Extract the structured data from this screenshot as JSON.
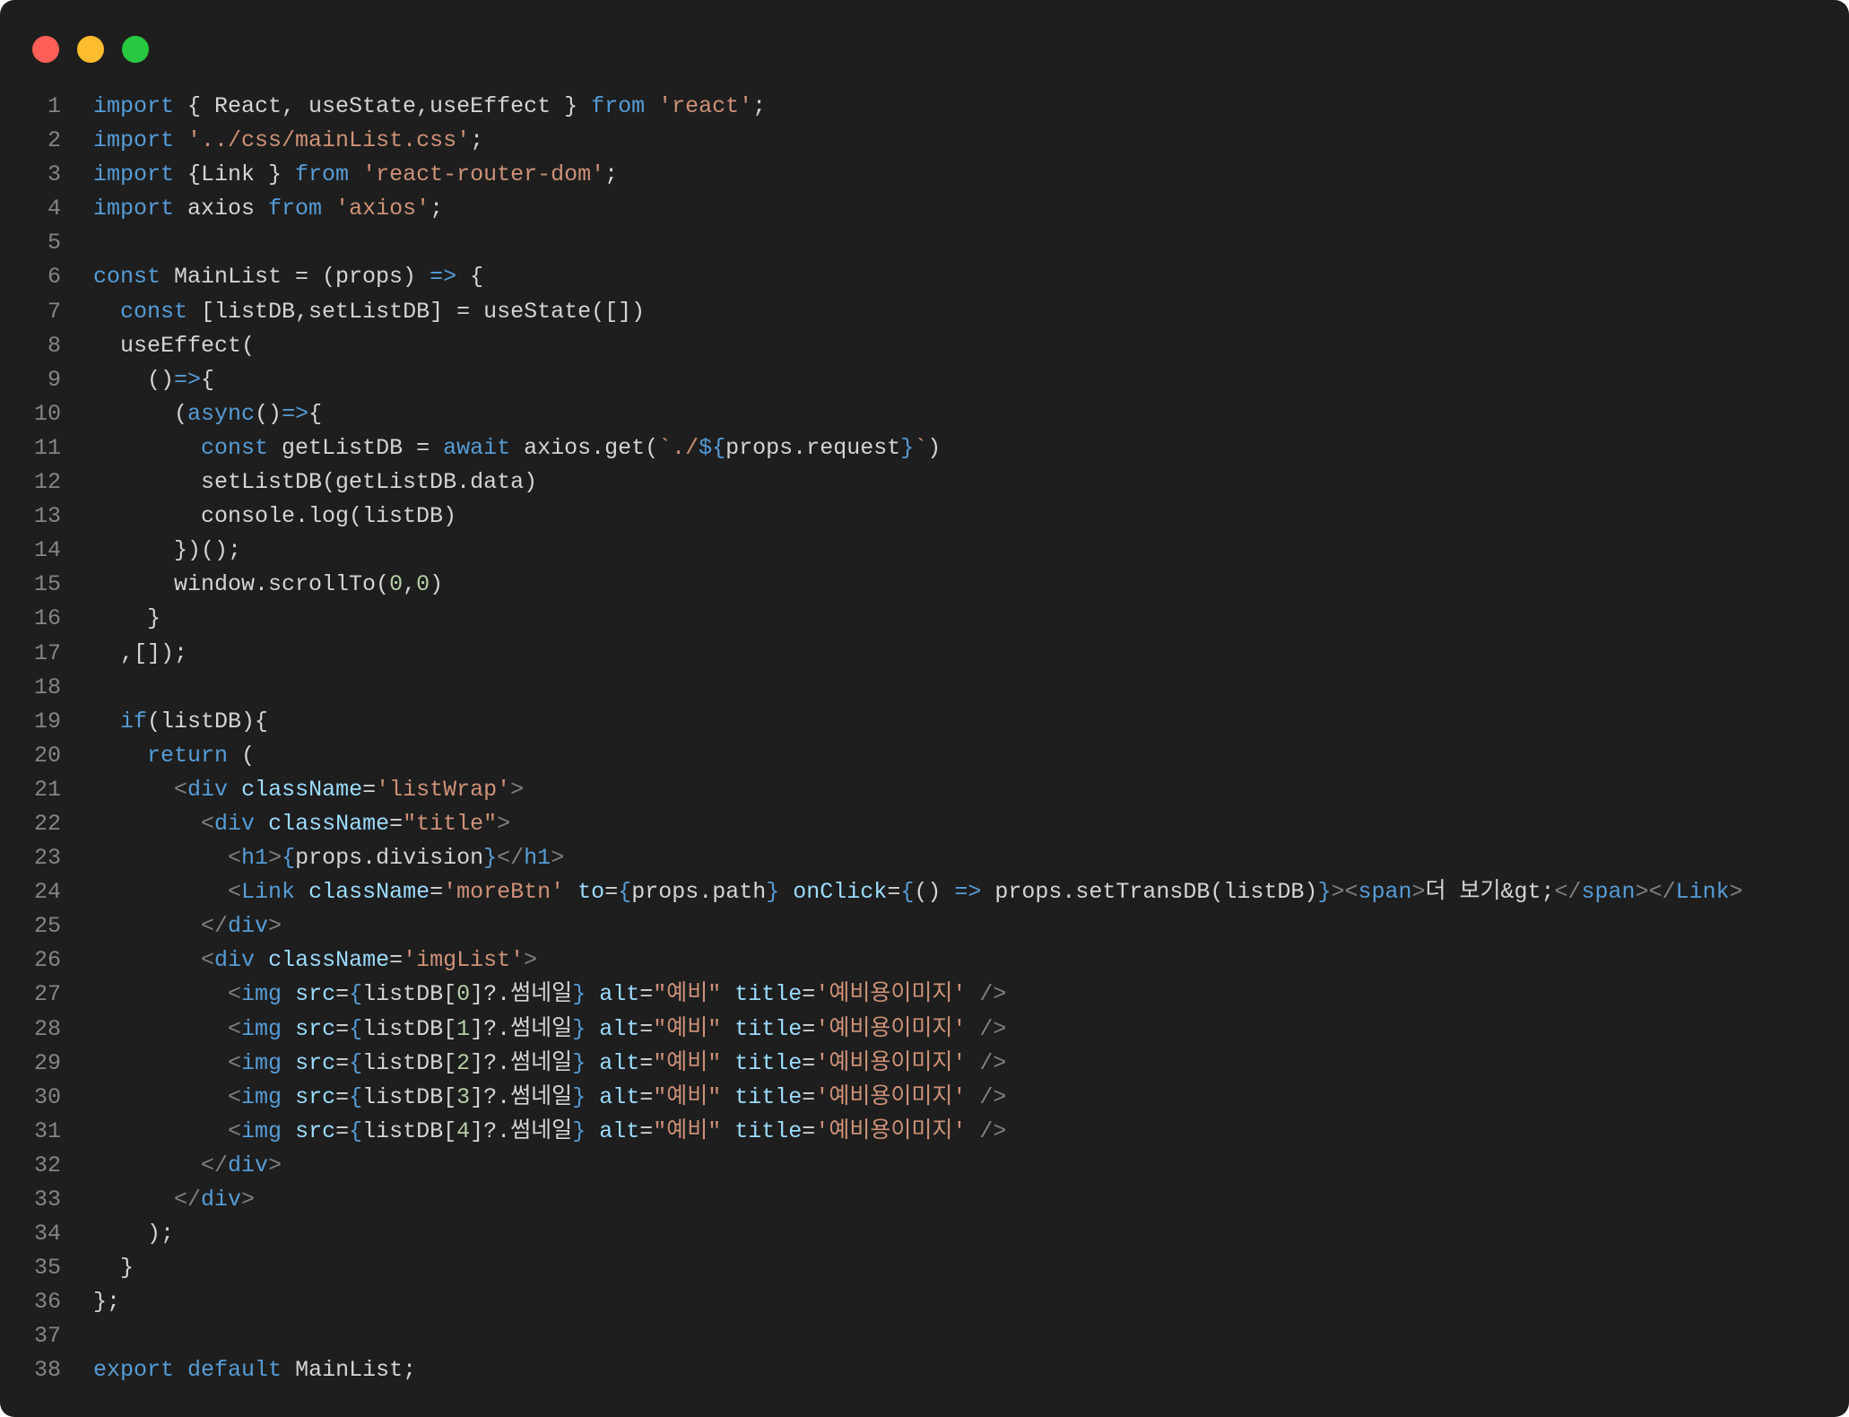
{
  "window": {
    "controls": [
      {
        "name": "close",
        "color": "#ff5f57"
      },
      {
        "name": "minimize",
        "color": "#febc2e"
      },
      {
        "name": "maximize",
        "color": "#28c840"
      }
    ],
    "background": "#1e1e1e"
  },
  "theme": {
    "keyword": "#569cd6",
    "string": "#ce9178",
    "attribute": "#9cdcfe",
    "number": "#b5cea8",
    "punctuation": "#808080",
    "text": "#d4d4d4",
    "line_number": "#858585"
  },
  "code": {
    "language": "jsx",
    "lines": [
      {
        "n": "1",
        "tokens": [
          [
            "kw",
            "import"
          ],
          [
            "txt",
            " { React, useState,useEffect } "
          ],
          [
            "kw",
            "from"
          ],
          [
            "txt",
            " "
          ],
          [
            "str",
            "'react'"
          ],
          [
            "txt",
            ";"
          ]
        ]
      },
      {
        "n": "2",
        "tokens": [
          [
            "kw",
            "import"
          ],
          [
            "txt",
            " "
          ],
          [
            "str",
            "'../css/mainList.css'"
          ],
          [
            "txt",
            ";"
          ]
        ]
      },
      {
        "n": "3",
        "tokens": [
          [
            "kw",
            "import"
          ],
          [
            "txt",
            " {Link } "
          ],
          [
            "kw",
            "from"
          ],
          [
            "txt",
            " "
          ],
          [
            "str",
            "'react-router-dom'"
          ],
          [
            "txt",
            ";"
          ]
        ]
      },
      {
        "n": "4",
        "tokens": [
          [
            "kw",
            "import"
          ],
          [
            "txt",
            " axios "
          ],
          [
            "kw",
            "from"
          ],
          [
            "txt",
            " "
          ],
          [
            "str",
            "'axios'"
          ],
          [
            "txt",
            ";"
          ]
        ]
      },
      {
        "n": "5",
        "tokens": []
      },
      {
        "n": "6",
        "tokens": [
          [
            "kw",
            "const"
          ],
          [
            "txt",
            " MainList = (props) "
          ],
          [
            "kw",
            "=>"
          ],
          [
            "txt",
            " {"
          ]
        ]
      },
      {
        "n": "7",
        "tokens": [
          [
            "txt",
            "  "
          ],
          [
            "kw",
            "const"
          ],
          [
            "txt",
            " [listDB,setListDB] = useState([])"
          ]
        ]
      },
      {
        "n": "8",
        "tokens": [
          [
            "txt",
            "  useEffect("
          ]
        ]
      },
      {
        "n": "9",
        "tokens": [
          [
            "txt",
            "    ()"
          ],
          [
            "kw",
            "=>"
          ],
          [
            "txt",
            "{"
          ]
        ]
      },
      {
        "n": "10",
        "tokens": [
          [
            "txt",
            "      ("
          ],
          [
            "kw",
            "async"
          ],
          [
            "txt",
            "()"
          ],
          [
            "kw",
            "=>"
          ],
          [
            "txt",
            "{"
          ]
        ]
      },
      {
        "n": "11",
        "tokens": [
          [
            "txt",
            "        "
          ],
          [
            "kw",
            "const"
          ],
          [
            "txt",
            " getListDB = "
          ],
          [
            "kw",
            "await"
          ],
          [
            "txt",
            " axios.get("
          ],
          [
            "str",
            "`./"
          ],
          [
            "kw",
            "${"
          ],
          [
            "txt",
            "props.request"
          ],
          [
            "kw",
            "}"
          ],
          [
            "str",
            "`"
          ],
          [
            "txt",
            ")"
          ]
        ]
      },
      {
        "n": "12",
        "tokens": [
          [
            "txt",
            "        setListDB(getListDB.data)"
          ]
        ]
      },
      {
        "n": "13",
        "tokens": [
          [
            "txt",
            "        console.log(listDB)"
          ]
        ]
      },
      {
        "n": "14",
        "tokens": [
          [
            "txt",
            "      })();"
          ]
        ]
      },
      {
        "n": "15",
        "tokens": [
          [
            "txt",
            "      window.scrollTo("
          ],
          [
            "num",
            "0"
          ],
          [
            "txt",
            ","
          ],
          [
            "num",
            "0"
          ],
          [
            "txt",
            ")"
          ]
        ]
      },
      {
        "n": "16",
        "tokens": [
          [
            "txt",
            "    }"
          ]
        ]
      },
      {
        "n": "17",
        "tokens": [
          [
            "txt",
            "  ,[]);"
          ]
        ]
      },
      {
        "n": "18",
        "tokens": []
      },
      {
        "n": "19",
        "tokens": [
          [
            "txt",
            "  "
          ],
          [
            "kw",
            "if"
          ],
          [
            "txt",
            "(listDB){"
          ]
        ]
      },
      {
        "n": "20",
        "tokens": [
          [
            "txt",
            "    "
          ],
          [
            "kw",
            "return"
          ],
          [
            "txt",
            " ("
          ]
        ]
      },
      {
        "n": "21",
        "tokens": [
          [
            "txt",
            "      "
          ],
          [
            "pun",
            "<"
          ],
          [
            "kw",
            "div"
          ],
          [
            "txt",
            " "
          ],
          [
            "attr",
            "className"
          ],
          [
            "txt",
            "="
          ],
          [
            "str",
            "'listWrap'"
          ],
          [
            "pun",
            ">"
          ]
        ]
      },
      {
        "n": "22",
        "tokens": [
          [
            "txt",
            "        "
          ],
          [
            "pun",
            "<"
          ],
          [
            "kw",
            "div"
          ],
          [
            "txt",
            " "
          ],
          [
            "attr",
            "className"
          ],
          [
            "txt",
            "="
          ],
          [
            "str",
            "\"title\""
          ],
          [
            "pun",
            ">"
          ]
        ]
      },
      {
        "n": "23",
        "tokens": [
          [
            "txt",
            "          "
          ],
          [
            "pun",
            "<"
          ],
          [
            "kw",
            "h1"
          ],
          [
            "pun",
            ">"
          ],
          [
            "kw",
            "{"
          ],
          [
            "txt",
            "props.division"
          ],
          [
            "kw",
            "}"
          ],
          [
            "pun",
            "</"
          ],
          [
            "kw",
            "h1"
          ],
          [
            "pun",
            ">"
          ]
        ]
      },
      {
        "n": "24",
        "tokens": [
          [
            "txt",
            "          "
          ],
          [
            "pun",
            "<"
          ],
          [
            "kw",
            "Link"
          ],
          [
            "txt",
            " "
          ],
          [
            "attr",
            "className"
          ],
          [
            "txt",
            "="
          ],
          [
            "str",
            "'moreBtn'"
          ],
          [
            "txt",
            " "
          ],
          [
            "attr",
            "to"
          ],
          [
            "txt",
            "="
          ],
          [
            "kw",
            "{"
          ],
          [
            "txt",
            "props.path"
          ],
          [
            "kw",
            "}"
          ],
          [
            "txt",
            " "
          ],
          [
            "attr",
            "onClick"
          ],
          [
            "txt",
            "="
          ],
          [
            "kw",
            "{"
          ],
          [
            "txt",
            "() "
          ],
          [
            "kw",
            "=>"
          ],
          [
            "txt",
            " props.setTransDB(listDB)"
          ],
          [
            "kw",
            "}"
          ],
          [
            "pun",
            ">"
          ],
          [
            "pun",
            "<"
          ],
          [
            "kw",
            "span"
          ],
          [
            "pun",
            ">"
          ],
          [
            "txt",
            "더 보기&gt;"
          ],
          [
            "pun",
            "</"
          ],
          [
            "kw",
            "span"
          ],
          [
            "pun",
            ">"
          ],
          [
            "pun",
            "</"
          ],
          [
            "kw",
            "Link"
          ],
          [
            "pun",
            ">"
          ]
        ]
      },
      {
        "n": "25",
        "tokens": [
          [
            "txt",
            "        "
          ],
          [
            "pun",
            "</"
          ],
          [
            "kw",
            "div"
          ],
          [
            "pun",
            ">"
          ]
        ]
      },
      {
        "n": "26",
        "tokens": [
          [
            "txt",
            "        "
          ],
          [
            "pun",
            "<"
          ],
          [
            "kw",
            "div"
          ],
          [
            "txt",
            " "
          ],
          [
            "attr",
            "className"
          ],
          [
            "txt",
            "="
          ],
          [
            "str",
            "'imgList'"
          ],
          [
            "pun",
            ">"
          ]
        ]
      },
      {
        "n": "27",
        "tokens": [
          [
            "txt",
            "          "
          ],
          [
            "pun",
            "<"
          ],
          [
            "kw",
            "img"
          ],
          [
            "txt",
            " "
          ],
          [
            "attr",
            "src"
          ],
          [
            "txt",
            "="
          ],
          [
            "kw",
            "{"
          ],
          [
            "txt",
            "listDB["
          ],
          [
            "num",
            "0"
          ],
          [
            "txt",
            "]?.썸네일"
          ],
          [
            "kw",
            "}"
          ],
          [
            "txt",
            " "
          ],
          [
            "attr",
            "alt"
          ],
          [
            "txt",
            "="
          ],
          [
            "str",
            "\"예비\""
          ],
          [
            "txt",
            " "
          ],
          [
            "attr",
            "title"
          ],
          [
            "txt",
            "="
          ],
          [
            "str",
            "'예비용이미지'"
          ],
          [
            "txt",
            " "
          ],
          [
            "pun",
            "/>"
          ]
        ]
      },
      {
        "n": "28",
        "tokens": [
          [
            "txt",
            "          "
          ],
          [
            "pun",
            "<"
          ],
          [
            "kw",
            "img"
          ],
          [
            "txt",
            " "
          ],
          [
            "attr",
            "src"
          ],
          [
            "txt",
            "="
          ],
          [
            "kw",
            "{"
          ],
          [
            "txt",
            "listDB["
          ],
          [
            "num",
            "1"
          ],
          [
            "txt",
            "]?.썸네일"
          ],
          [
            "kw",
            "}"
          ],
          [
            "txt",
            " "
          ],
          [
            "attr",
            "alt"
          ],
          [
            "txt",
            "="
          ],
          [
            "str",
            "\"예비\""
          ],
          [
            "txt",
            " "
          ],
          [
            "attr",
            "title"
          ],
          [
            "txt",
            "="
          ],
          [
            "str",
            "'예비용이미지'"
          ],
          [
            "txt",
            " "
          ],
          [
            "pun",
            "/>"
          ]
        ]
      },
      {
        "n": "29",
        "tokens": [
          [
            "txt",
            "          "
          ],
          [
            "pun",
            "<"
          ],
          [
            "kw",
            "img"
          ],
          [
            "txt",
            " "
          ],
          [
            "attr",
            "src"
          ],
          [
            "txt",
            "="
          ],
          [
            "kw",
            "{"
          ],
          [
            "txt",
            "listDB["
          ],
          [
            "num",
            "2"
          ],
          [
            "txt",
            "]?.썸네일"
          ],
          [
            "kw",
            "}"
          ],
          [
            "txt",
            " "
          ],
          [
            "attr",
            "alt"
          ],
          [
            "txt",
            "="
          ],
          [
            "str",
            "\"예비\""
          ],
          [
            "txt",
            " "
          ],
          [
            "attr",
            "title"
          ],
          [
            "txt",
            "="
          ],
          [
            "str",
            "'예비용이미지'"
          ],
          [
            "txt",
            " "
          ],
          [
            "pun",
            "/>"
          ]
        ]
      },
      {
        "n": "30",
        "tokens": [
          [
            "txt",
            "          "
          ],
          [
            "pun",
            "<"
          ],
          [
            "kw",
            "img"
          ],
          [
            "txt",
            " "
          ],
          [
            "attr",
            "src"
          ],
          [
            "txt",
            "="
          ],
          [
            "kw",
            "{"
          ],
          [
            "txt",
            "listDB["
          ],
          [
            "num",
            "3"
          ],
          [
            "txt",
            "]?.썸네일"
          ],
          [
            "kw",
            "}"
          ],
          [
            "txt",
            " "
          ],
          [
            "attr",
            "alt"
          ],
          [
            "txt",
            "="
          ],
          [
            "str",
            "\"예비\""
          ],
          [
            "txt",
            " "
          ],
          [
            "attr",
            "title"
          ],
          [
            "txt",
            "="
          ],
          [
            "str",
            "'예비용이미지'"
          ],
          [
            "txt",
            " "
          ],
          [
            "pun",
            "/>"
          ]
        ]
      },
      {
        "n": "31",
        "tokens": [
          [
            "txt",
            "          "
          ],
          [
            "pun",
            "<"
          ],
          [
            "kw",
            "img"
          ],
          [
            "txt",
            " "
          ],
          [
            "attr",
            "src"
          ],
          [
            "txt",
            "="
          ],
          [
            "kw",
            "{"
          ],
          [
            "txt",
            "listDB["
          ],
          [
            "num",
            "4"
          ],
          [
            "txt",
            "]?.썸네일"
          ],
          [
            "kw",
            "}"
          ],
          [
            "txt",
            " "
          ],
          [
            "attr",
            "alt"
          ],
          [
            "txt",
            "="
          ],
          [
            "str",
            "\"예비\""
          ],
          [
            "txt",
            " "
          ],
          [
            "attr",
            "title"
          ],
          [
            "txt",
            "="
          ],
          [
            "str",
            "'예비용이미지'"
          ],
          [
            "txt",
            " "
          ],
          [
            "pun",
            "/>"
          ]
        ]
      },
      {
        "n": "32",
        "tokens": [
          [
            "txt",
            "        "
          ],
          [
            "pun",
            "</"
          ],
          [
            "kw",
            "div"
          ],
          [
            "pun",
            ">"
          ]
        ]
      },
      {
        "n": "33",
        "tokens": [
          [
            "txt",
            "      "
          ],
          [
            "pun",
            "</"
          ],
          [
            "kw",
            "div"
          ],
          [
            "pun",
            ">"
          ]
        ]
      },
      {
        "n": "34",
        "tokens": [
          [
            "txt",
            "    );"
          ]
        ]
      },
      {
        "n": "35",
        "tokens": [
          [
            "txt",
            "  }"
          ]
        ]
      },
      {
        "n": "36",
        "tokens": [
          [
            "txt",
            "};"
          ]
        ]
      },
      {
        "n": "37",
        "tokens": []
      },
      {
        "n": "38",
        "tokens": [
          [
            "kw",
            "export"
          ],
          [
            "txt",
            " "
          ],
          [
            "kw",
            "default"
          ],
          [
            "txt",
            " MainList;"
          ]
        ]
      }
    ]
  }
}
